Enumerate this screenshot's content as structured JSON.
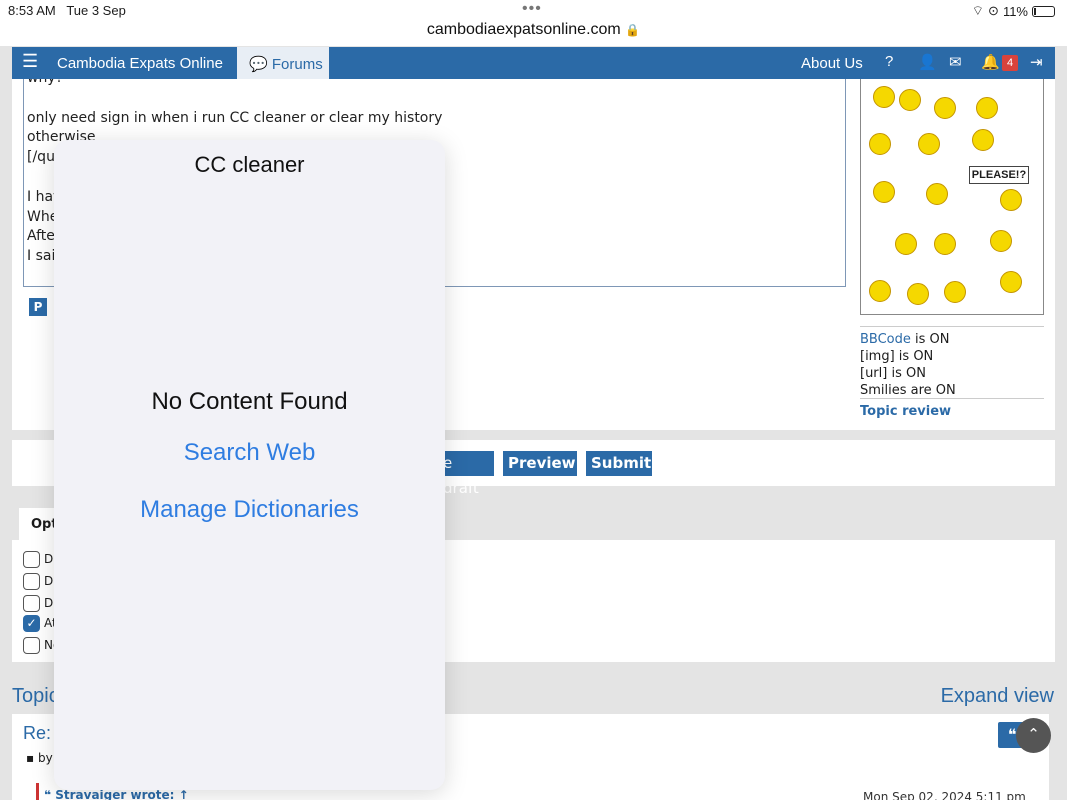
{
  "status_bar": {
    "time": "8:53 AM",
    "date": "Tue 3 Sep",
    "url": "cambodiaexpatsonline.com",
    "battery": "11%",
    "lock_icon": "lock-icon",
    "wifi_icon": "wifi-icon"
  },
  "navbar": {
    "menu_icon": "hamburger-icon",
    "site_name": "Cambodia Expats Online",
    "forums_label": "Forums",
    "about_label": "About Us",
    "notification_count": "4",
    "bg_color": "#2b6aa7"
  },
  "editor": {
    "lines": [
      "why?",
      "",
      "only need sign in when i run CC cleaner or clear my history",
      "otherwise",
      "[/qu",
      "",
      "I hav",
      "Whe",
      "Afte",
      "I sai"
    ]
  },
  "sidebar": {
    "please_sign": "PLEASE!?",
    "bbcode_label": "BBCode",
    "bbcode_status": "is ON",
    "img_status": "[img] is ON",
    "url_status": "[url] is ON",
    "smilies_status": "Smilies are ON",
    "topic_review": "Topic review"
  },
  "buttons": {
    "draft": "e draft",
    "preview": "Preview",
    "submit": "Submit"
  },
  "options": {
    "tab_label": "Opt",
    "items": [
      {
        "label": "D",
        "checked": false
      },
      {
        "label": "D",
        "checked": false
      },
      {
        "label": "D",
        "checked": false
      },
      {
        "label": "At",
        "checked": true
      },
      {
        "label": "No",
        "checked": false
      }
    ]
  },
  "topic": {
    "heading": "Topic",
    "expand_view": "Expand view",
    "post_title": "Re: (",
    "post_by": "by",
    "quote_author": "Stravaiger wrote: ↑",
    "quote_date": "Mon Sep 02, 2024 5:11 pm"
  },
  "popover": {
    "title": "CC cleaner",
    "empty_message": "No Content Found",
    "search_web": "Search Web",
    "manage_dictionaries": "Manage Dictionaries",
    "link_color": "#2f7de1"
  }
}
